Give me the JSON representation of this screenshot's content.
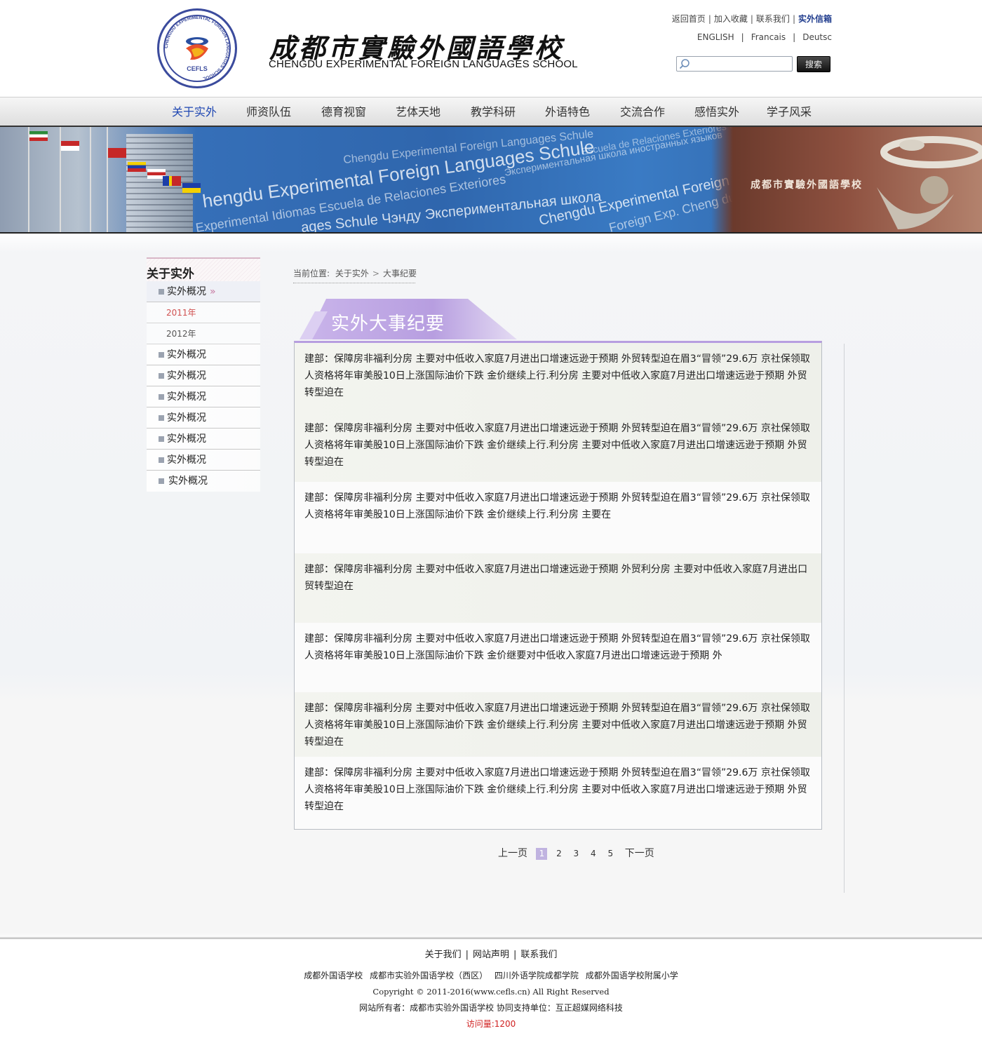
{
  "header": {
    "logo_abbr": "CEFLS",
    "logo_ring_text": "CHENGDU EXPERIMENTAL FOREIGN LANGUAGES SCHOOL",
    "school_name_cn": "成都市實驗外國語學校",
    "school_name_en": "CHENGDU EXPERIMENTAL FOREIGN LANGUAGES SCHOOL",
    "top_links": [
      "返回首页",
      "加入收藏",
      "联系我们",
      "实外信箱"
    ],
    "languages": [
      "ENGLISH",
      "Francais",
      "Deutsc"
    ],
    "search_placeholder": "",
    "search_button": "搜索"
  },
  "nav": {
    "items": [
      "关于实外",
      "师资队伍",
      "德育视窗",
      "艺体天地",
      "教学科研",
      "外语特色",
      "交流合作",
      "感悟实外",
      "学子风采"
    ],
    "active_index": 0
  },
  "banner": {
    "gate_sign": "成都市實驗外國語學校"
  },
  "sidebar": {
    "title": "关于实外",
    "current_item": "实外概况",
    "sub_items": [
      "2011年",
      "2012年"
    ],
    "items": [
      "实外概况",
      "实外概况",
      "实外概况",
      "实外概况",
      "实外概况",
      "实外概况",
      "实外概况"
    ]
  },
  "breadcrumb": {
    "prefix": "当前位置:",
    "level1": "关于实外",
    "level2": "大事纪要"
  },
  "section_title": "实外大事纪要",
  "entries": [
    "建部：保障房非福利分房 主要对中低收入家庭7月进出口增速远逊于预期 外贸转型迫在眉3“冒领”29.6万 京社保领取人资格将年审美股10日上涨国际油价下跌 金价继续上行.利分房 主要对中低收入家庭7月进出口增速远逊于预期 外贸转型迫在",
    "建部：保障房非福利分房 主要对中低收入家庭7月进出口增速远逊于预期 外贸转型迫在眉3“冒领”29.6万 京社保领取人资格将年审美股10日上涨国际油价下跌 金价继续上行.利分房 主要对中低收入家庭7月进出口增速远逊于预期 外贸转型迫在",
    "建部：保障房非福利分房 主要对中低收入家庭7月进出口增速远逊于预期 外贸转型迫在眉3“冒领”29.6万 京社保领取人资格将年审美股10日上涨国际油价下跌 金价继续上行.利分房 主要在",
    "建部：保障房非福利分房 主要对中低收入家庭7月进出口增速远逊于预期 外贸利分房 主要对中低收入家庭7月进出口贸转型迫在",
    "建部：保障房非福利分房 主要对中低收入家庭7月进出口增速远逊于预期 外贸转型迫在眉3“冒领”29.6万 京社保领取人资格将年审美股10日上涨国际油价下跌 金价继要对中低收入家庭7月进出口增速远逊于预期 外",
    "建部：保障房非福利分房 主要对中低收入家庭7月进出口增速远逊于预期 外贸转型迫在眉3“冒领”29.6万 京社保领取人资格将年审美股10日上涨国际油价下跌 金价继续上行.利分房 主要对中低收入家庭7月进出口增速远逊于预期 外贸转型迫在",
    "建部：保障房非福利分房 主要对中低收入家庭7月进出口增速远逊于预期 外贸转型迫在眉3“冒领”29.6万 京社保领取人资格将年审美股10日上涨国际油价下跌 金价继续上行.利分房 主要对中低收入家庭7月进出口增速远逊于预期 外贸转型迫在"
  ],
  "pager": {
    "prev": "上一页",
    "pages": [
      "1",
      "2",
      "3",
      "4",
      "5"
    ],
    "current": "1",
    "next": "下一页"
  },
  "footer": {
    "links": [
      "关于我们",
      "网站声明",
      "联系我们"
    ],
    "schools": [
      "成都外国语学校",
      "成都市实验外国语学校（西区）",
      "四川外语学院成都学院",
      "成都外国语学校附属小学"
    ],
    "copyright": "Copyright © 2011-2016(www.cefls.cn) All Right Reserved",
    "owner": "网站所有者：成都市实验外国语学校 协同支持单位：互正超媒网络科技",
    "visits": "访问量:1200"
  },
  "colors": {
    "nav_active": "#1f47b2",
    "ribbon": "#b79ee0",
    "sidebar_sub_active": "#d05050",
    "visits": "#d02020",
    "brand_blue": "#3b4b9d"
  }
}
